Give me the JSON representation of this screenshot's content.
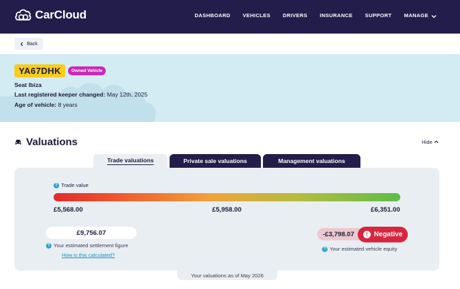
{
  "header": {
    "brand": "CarCloud",
    "nav": [
      "DASHBOARD",
      "VEHICLES",
      "DRIVERS",
      "INSURANCE",
      "SUPPORT",
      "MANAGE"
    ]
  },
  "back": {
    "label": "Back"
  },
  "vehicle": {
    "plate": "YA67DHK",
    "ownership_badge": "Owned Vehicle",
    "model": "Seat Ibiza",
    "keeper_label": "Last registered keeper changed:",
    "keeper_value": "May 12th, 2025",
    "age_label": "Age of vehicle:",
    "age_value": "8 years"
  },
  "valuations": {
    "title": "Valuations",
    "hide_label": "Hide",
    "tabs": [
      {
        "label": "Trade valuations",
        "active": true
      },
      {
        "label": "Private sale valuations",
        "active": false
      },
      {
        "label": "Management valuations",
        "active": false
      }
    ],
    "trade_label": "Trade value",
    "range": {
      "low": "£5,568.00",
      "mid": "£5,958.00",
      "high": "£6,351.00"
    },
    "settlement_value": "£9,756.07",
    "settlement_label": "Your estimated settlement figure",
    "calc_link": "How is this calculated?",
    "equity_value": "-£3,798.07",
    "equity_status": "Negative",
    "equity_label": "Your estimated vehicle equity",
    "as_of": "Your valuations as of May 2026"
  },
  "colors": {
    "navy": "#231d4b",
    "plate_yellow": "#f8cc1e",
    "badge_magenta": "#c92ab7",
    "negative_red": "#d7263d",
    "link_blue": "#1d8fbf"
  }
}
